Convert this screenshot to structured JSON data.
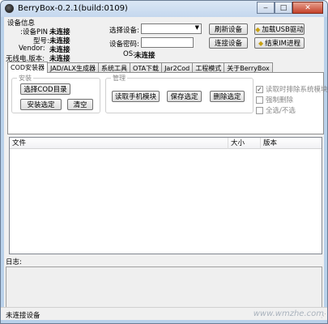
{
  "window": {
    "title": "BerryBox-0.2.1(build:0109)",
    "controls": {
      "minimize": "‒",
      "maximize": "□",
      "close": "✕"
    }
  },
  "device_info": {
    "group_title": "设备信息",
    "rows": [
      {
        "label": "设备PIN:",
        "value": "未连接"
      },
      {
        "label": "型号:",
        "value": "未连接"
      },
      {
        "label": "Vendor:",
        "value": "未连接"
      },
      {
        "label": "无线电.版本:",
        "value": "未连接"
      }
    ],
    "select_device_label": "选择设备:",
    "select_device_value": "",
    "password_label": "设备密码:",
    "password_value": "",
    "os_label": "OS:",
    "os_value": "未连接",
    "refresh_button": "刷新设备",
    "connect_button": "连接设备",
    "load_usb_button": "加载USB驱动",
    "end_process_button": "结束IM进程"
  },
  "tabs": [
    {
      "label": "COD安装器",
      "active": true
    },
    {
      "label": "JAD/ALX生成器",
      "active": false
    },
    {
      "label": "系统工具",
      "active": false
    },
    {
      "label": "OTA下载",
      "active": false
    },
    {
      "label": "Jar2Cod",
      "active": false
    },
    {
      "label": "工程模式",
      "active": false
    },
    {
      "label": "关于BerryBox",
      "active": false
    }
  ],
  "install_group": {
    "title": "安装",
    "select_cod_button": "选择COD目录",
    "install_selected_button": "安装选定",
    "clear_button": "清空"
  },
  "manage_group": {
    "title": "管理",
    "read_modules_button": "读取手机模块",
    "save_selected_button": "保存选定",
    "delete_selected_button": "删除选定"
  },
  "options": [
    {
      "label": "读取时排除系统模块",
      "checked": true
    },
    {
      "label": "强制删除",
      "checked": false
    },
    {
      "label": "全选/不选",
      "checked": false
    }
  ],
  "file_list": {
    "columns": [
      "文件",
      "大小",
      "版本"
    ],
    "rows": []
  },
  "log": {
    "label": "日志:",
    "content": ""
  },
  "status": {
    "text": "未连接设备",
    "watermark": "www.wmzhe.com"
  },
  "colors": {
    "title_bar": "#c4d7ee",
    "client_bg": "#f0f0f0"
  }
}
